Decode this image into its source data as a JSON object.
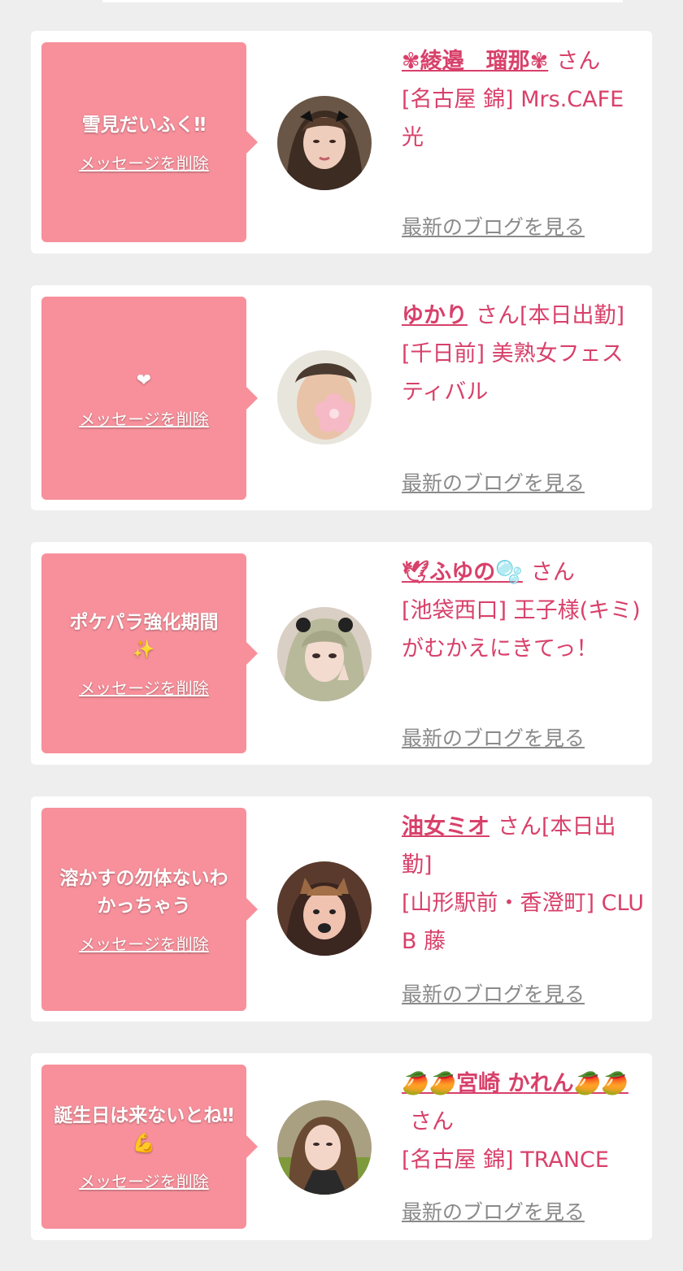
{
  "cards": [
    {
      "message": "雪見だいふく‼",
      "message_emoji": "",
      "delete_label": "メッセージを削除",
      "name": "✾綾邉　瑠那✾",
      "suffix": "さん",
      "shop": "[名古屋 錦] Mrs.CAFE光",
      "blog_label": "最新のブログを見る"
    },
    {
      "message": "",
      "message_emoji": "❤",
      "delete_label": "メッセージを削除",
      "name": "ゆかり",
      "suffix": "さん[本日出勤]",
      "shop": "[千日前] 美熟女フェスティバル",
      "blog_label": "最新のブログを見る"
    },
    {
      "message": "ポケパラ強化期間",
      "message_emoji": "✨",
      "delete_label": "メッセージを削除",
      "name": "🕊ふゆの🫧",
      "suffix": "さん",
      "shop": "[池袋西口] 王子様(キミ)がむかえにきてっ！",
      "blog_label": "最新のブログを見る"
    },
    {
      "message": "溶かすの勿体ないわかっちゃう",
      "message_emoji": "",
      "delete_label": "メッセージを削除",
      "name": "油女ミオ",
      "suffix": "さん[本日出勤]",
      "shop": "[山形駅前・香澄町] CLUB 藤",
      "blog_label": "最新のブログを見る"
    },
    {
      "message": "誕生日は来ないとね‼💪",
      "message_emoji": "",
      "delete_label": "メッセージを削除",
      "name": "🥭🥭宮崎 かれん🥭🥭",
      "suffix": "さん",
      "shop": "[名古屋 錦] TRANCE",
      "blog_label": "最新のブログを見る"
    }
  ],
  "colors": {
    "bubble": "#f7909b",
    "accent_text": "#d8406a",
    "link_gray": "#8a8a8a",
    "page_bg": "#eeeeee"
  }
}
